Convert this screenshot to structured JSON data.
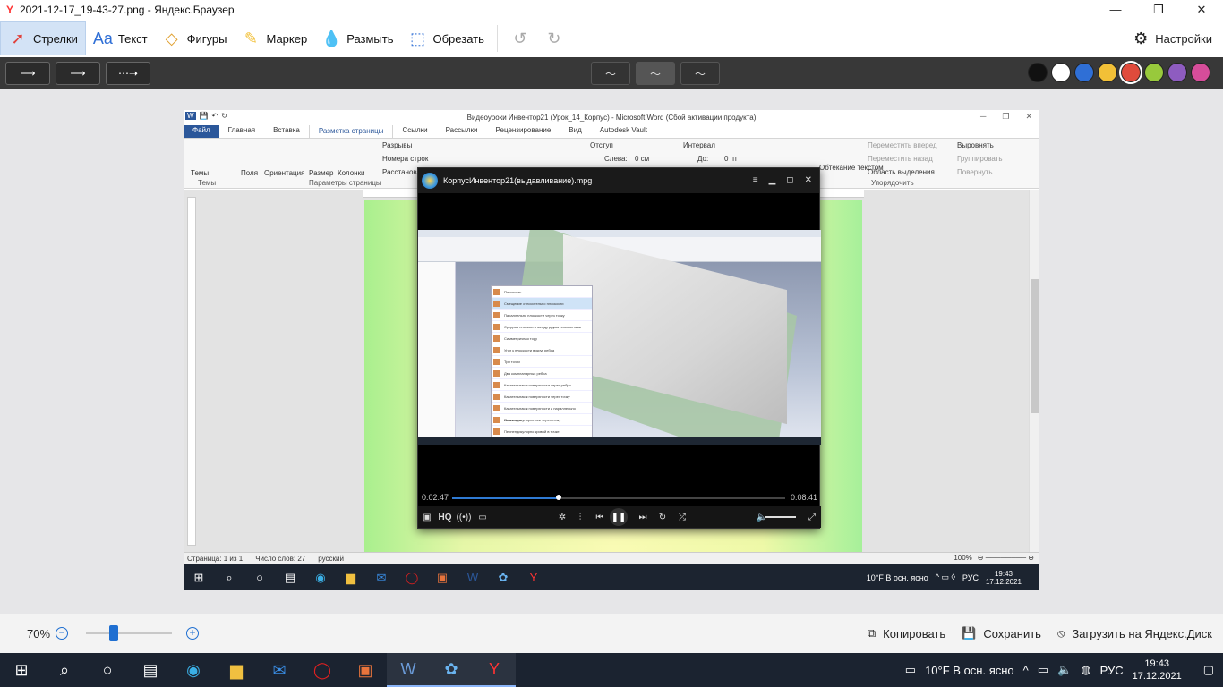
{
  "window": {
    "title": "2021-12-17_19-43-27.png - Яндекс.Браузер",
    "min": "—",
    "max": "❐",
    "close": "✕"
  },
  "toolbar": {
    "arrows": "Стрелки",
    "text": "Текст",
    "shapes": "Фигуры",
    "marker": "Маркер",
    "blur": "Размыть",
    "crop": "Обрезать",
    "settings": "Настройки"
  },
  "colors": [
    "#111111",
    "#ffffff",
    "#2f6fd6",
    "#f2c037",
    "#e04b3c",
    "#98c93c",
    "#8e5cc0",
    "#d64d9a"
  ],
  "word": {
    "title": "Видеоуроки Инвентор21 (Урок_14_Корпус) - Microsoft Word (Сбой активации продукта)",
    "tabs": [
      "Файл",
      "Главная",
      "Вставка",
      "Разметка страницы",
      "Ссылки",
      "Рассылки",
      "Рецензирование",
      "Вид",
      "Autodesk Vault"
    ],
    "ribbon": {
      "themes": "Темы",
      "fields": "Поля",
      "orientation": "Ориентация",
      "size": "Размер",
      "columns": "Колонки",
      "breaks": "Разрывы",
      "line_numbers": "Номера строк",
      "hyphenation": "Расстанов",
      "page_setup": "Параметры страницы",
      "themes_group": "Темы",
      "indent": "Отступ",
      "left": "Слева:",
      "left_val": "0 см",
      "spacing": "Интервал",
      "before": "До:",
      "before_val": "0 пт",
      "bring_forward": "Переместить вперед",
      "send_back": "Переместить назад",
      "selection_pane": "Область выделения",
      "align": "Выровнять",
      "group": "Группировать",
      "rotate": "Повернуть",
      "wrap": "Обтекание текстом",
      "arrange": "Упорядочить"
    },
    "status": {
      "page": "Страница: 1 из 1",
      "words": "Число слов: 27",
      "lang": "русский",
      "zoom": "100%"
    },
    "taskbar": {
      "weather": "10°F  В осн. ясно",
      "lang": "РУС",
      "time": "19:43",
      "date": "17.12.2021"
    }
  },
  "player": {
    "title": "КорпусИнвентор21(выдавливание).mpg",
    "elapsed": "0:02:47",
    "total": "0:08:41",
    "progress": 0.32,
    "hq": "HQ",
    "menu": [
      "Плоскость",
      "Смещение относительно плоскости",
      "Параллельно плоскости через точку",
      "Средняя плоскость между двумя плоскостями",
      "Симметричная тору",
      "Угол к плоскости вокруг ребра",
      "Три точки",
      "Два компланарных ребра",
      "Касательная к поверхности через ребро",
      "Касательная к поверхности через точку",
      "Касательная к поверхности и параллельно плоскости",
      "Перпендикулярно оси через точку",
      "Перпендикулярно кривой в точке"
    ]
  },
  "zoom": {
    "level": "70%",
    "minus": "−",
    "plus": "+"
  },
  "actions": {
    "copy": "Копировать",
    "save": "Сохранить",
    "upload": "Загрузить на Яндекс.Диск"
  },
  "taskbar": {
    "weather": "10°F  В осн. ясно",
    "lang": "РУС",
    "time": "19:43",
    "date": "17.12.2021"
  }
}
